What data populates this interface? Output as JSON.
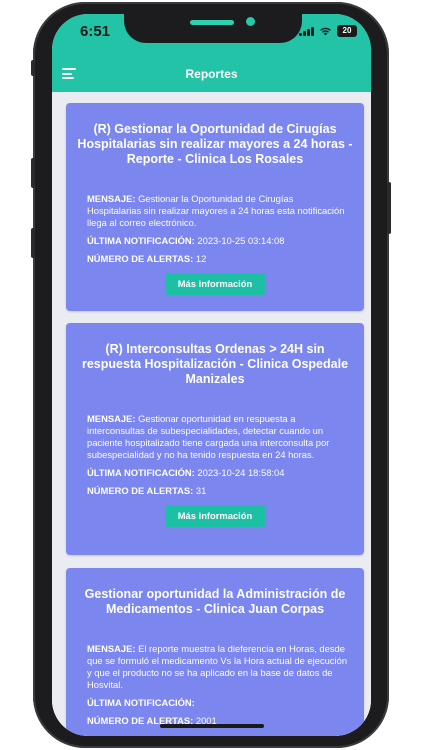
{
  "status_bar": {
    "time": "6:51",
    "battery": "20"
  },
  "app_bar": {
    "title": "Reportes",
    "menu_icon": "hamburger-menu-icon"
  },
  "colors": {
    "accent": "#22c3a6",
    "card": "#7b86ee",
    "button": "#1dbfa5"
  },
  "labels": {
    "message": "MENSAJE:",
    "last_notification": "ÚLTIMA NOTIFICACIÓN:",
    "alert_count": "NÚMERO DE ALERTAS:",
    "more_info": "Más información"
  },
  "reports": [
    {
      "title": "(R) Gestionar la Oportunidad de Cirugías Hospitalarias sin realizar mayores a 24 horas - Reporte - Clinica Los Rosales",
      "message": "Gestionar la Oportunidad de Cirugías Hospitalarias sin realizar mayores a 24 horas esta notificación llega al correo electrónico.",
      "last_notification": "2023-10-25 03:14:08",
      "alerts": "12"
    },
    {
      "title": "(R) Interconsultas Ordenas > 24H sin respuesta Hospitalización  - Clinica Ospedale Manizales",
      "message": "Gestionar oportunidad en respuesta a interconsultas de subespecialidades, detectar cuando un paciente hospitalizado tiene cargada una interconsulta por subespecialidad  y no ha tenido respuesta en 24 horas.",
      "last_notification": "2023-10-24 18:58:04",
      "alerts": "31"
    },
    {
      "title": "Gestionar oportunidad la Administración de Medicamentos  - Clinica Juan Corpas",
      "message": "El reporte muestra la dieferencia en Horas, desde que se formuló el medicamento Vs la Hora actual de ejecución y que el producto no se ha aplicado en la base de datos de Hosvital.",
      "last_notification": "",
      "alerts": "2001"
    }
  ]
}
